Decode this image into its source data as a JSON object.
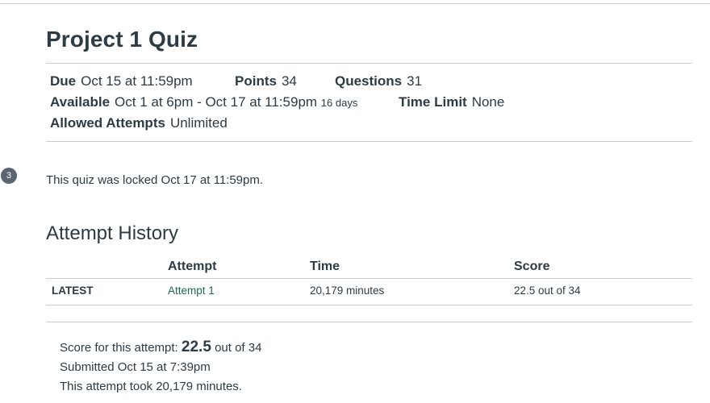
{
  "quiz": {
    "title": "Project 1 Quiz",
    "due_label": "Due",
    "due_value": "Oct 15 at 11:59pm",
    "points_label": "Points",
    "points_value": "34",
    "questions_label": "Questions",
    "questions_value": "31",
    "available_label": "Available",
    "available_value": "Oct 1 at 6pm - Oct 17 at 11:59pm",
    "available_days": "16 days",
    "time_limit_label": "Time Limit",
    "time_limit_value": "None",
    "attempts_label": "Allowed Attempts",
    "attempts_value": "Unlimited"
  },
  "notification": {
    "badge_count": "3",
    "locked_message": "This quiz was locked Oct 17 at 11:59pm."
  },
  "history": {
    "heading": "Attempt History",
    "columns": [
      "",
      "Attempt",
      "Time",
      "Score"
    ],
    "rows": [
      {
        "status": "LATEST",
        "attempt": "Attempt 1",
        "time": "20,179 minutes",
        "score": "22.5 out of 34"
      }
    ]
  },
  "summary": {
    "score_prefix": "Score for this attempt:",
    "score_value": "22.5",
    "score_suffix": "out of 34",
    "submitted": "Submitted Oct 15 at 7:39pm",
    "duration": "This attempt took 20,179 minutes."
  },
  "colors": {
    "text": "#2d3b45",
    "rule": "#c7cdd1",
    "link": "#1b6b4a",
    "badge": "#5b6670"
  }
}
